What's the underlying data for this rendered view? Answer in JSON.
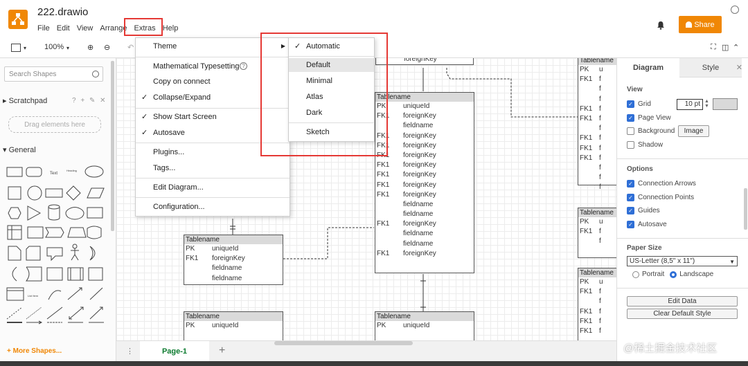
{
  "app": {
    "file_title": "222.drawio",
    "share_label": "Share"
  },
  "menubar": [
    "File",
    "Edit",
    "View",
    "Arrange",
    "Extras",
    "Help"
  ],
  "toolbar": {
    "zoom": "100%"
  },
  "left_panel": {
    "search_placeholder": "Search Shapes",
    "scratchpad_label": "Scratchpad",
    "scratchpad_tools": "? + ✎ ✕",
    "drag_hint": "Drag elements here",
    "general_label": "General",
    "more_shapes": "+ More Shapes..."
  },
  "extras_menu": {
    "theme": "Theme",
    "math": "Mathematical Typesetting",
    "copy_connect": "Copy on connect",
    "collapse": "Collapse/Expand",
    "start_screen": "Show Start Screen",
    "autosave": "Autosave",
    "plugins": "Plugins...",
    "tags": "Tags...",
    "edit_diagram": "Edit Diagram...",
    "configuration": "Configuration..."
  },
  "theme_menu": {
    "automatic": "Automatic",
    "default": "Default",
    "minimal": "Minimal",
    "atlas": "Atlas",
    "dark": "Dark",
    "sketch": "Sketch"
  },
  "tables": {
    "big": {
      "title": "Tablename",
      "rows": [
        [
          "PK",
          "uniqueId"
        ],
        [
          "FK1",
          "foreignKey"
        ],
        [
          "",
          "fieldname"
        ],
        [
          "FK1",
          "foreignKey"
        ],
        [
          "FK1",
          "foreignKey"
        ],
        [
          "FK1",
          "foreignKey"
        ],
        [
          "FK1",
          "foreignKey"
        ],
        [
          "FK1",
          "foreignKey"
        ],
        [
          "FK1",
          "foreignKey"
        ],
        [
          "FK1",
          "foreignKey"
        ],
        [
          "",
          "fieldname"
        ],
        [
          "",
          "fieldname"
        ],
        [
          "FK1",
          "foreignKey"
        ],
        [
          "",
          "fieldname"
        ],
        [
          "",
          "fieldname"
        ],
        [
          "FK1",
          "foreignKey"
        ]
      ]
    },
    "left_mid": {
      "title": "Tablename",
      "rows": [
        [
          "PK",
          "uniqueId"
        ],
        [
          "FK1",
          "foreignKey"
        ],
        [
          "",
          "fieldname"
        ],
        [
          "",
          "fieldname"
        ]
      ]
    },
    "left_bottom": {
      "title": "Tablename",
      "rows": [
        [
          "PK",
          "uniqueId"
        ],
        [
          "",
          ""
        ]
      ]
    },
    "mid_bottom": {
      "title": "Tablename",
      "rows": [
        [
          "PK",
          "uniqueId"
        ],
        [
          "",
          ""
        ]
      ]
    },
    "top_partial_text": "foreignKey",
    "right_top": {
      "title": "Tablename",
      "rows": [
        [
          "PK",
          "u"
        ],
        [
          "FK1",
          "f"
        ],
        [
          "",
          "f"
        ],
        [
          "",
          "f"
        ],
        [
          "FK1",
          "f"
        ],
        [
          "FK1",
          "f"
        ],
        [
          "",
          "f"
        ],
        [
          "FK1",
          "f"
        ],
        [
          "FK1",
          "f"
        ],
        [
          "FK1",
          "f"
        ],
        [
          "",
          "f"
        ],
        [
          "",
          "f"
        ],
        [
          "",
          "f"
        ]
      ]
    },
    "right_mid": {
      "title": "Tablename",
      "rows": [
        [
          "PK",
          "u"
        ],
        [
          "FK1",
          "f"
        ],
        [
          "",
          "f"
        ]
      ]
    },
    "right_bottom": {
      "title": "Tablename",
      "rows": [
        [
          "PK",
          "u"
        ],
        [
          "FK1",
          "f"
        ],
        [
          "",
          "f"
        ],
        [
          "FK1",
          "f"
        ],
        [
          "FK1",
          "f"
        ],
        [
          "FK1",
          "f"
        ]
      ]
    }
  },
  "right_panel": {
    "tab_diagram": "Diagram",
    "tab_style": "Style",
    "view_label": "View",
    "grid": "Grid",
    "grid_size": "10 pt",
    "page_view": "Page View",
    "background": "Background",
    "image_btn": "Image",
    "shadow": "Shadow",
    "options_label": "Options",
    "connection_arrows": "Connection Arrows",
    "connection_points": "Connection Points",
    "guides": "Guides",
    "autosave": "Autosave",
    "paper_size_label": "Paper Size",
    "paper_size": "US-Letter (8,5\" x 11\")",
    "portrait": "Portrait",
    "landscape": "Landscape",
    "edit_data": "Edit Data",
    "clear_style": "Clear Default Style"
  },
  "bottom": {
    "page_tab": "Page-1"
  },
  "watermark": "@稀土掘金技术社区",
  "colors": {
    "accent": "#f08705",
    "highlight_box": "#e53935",
    "checkbox": "#2f6fd6",
    "page_tab_text": "#0a7a2e"
  }
}
